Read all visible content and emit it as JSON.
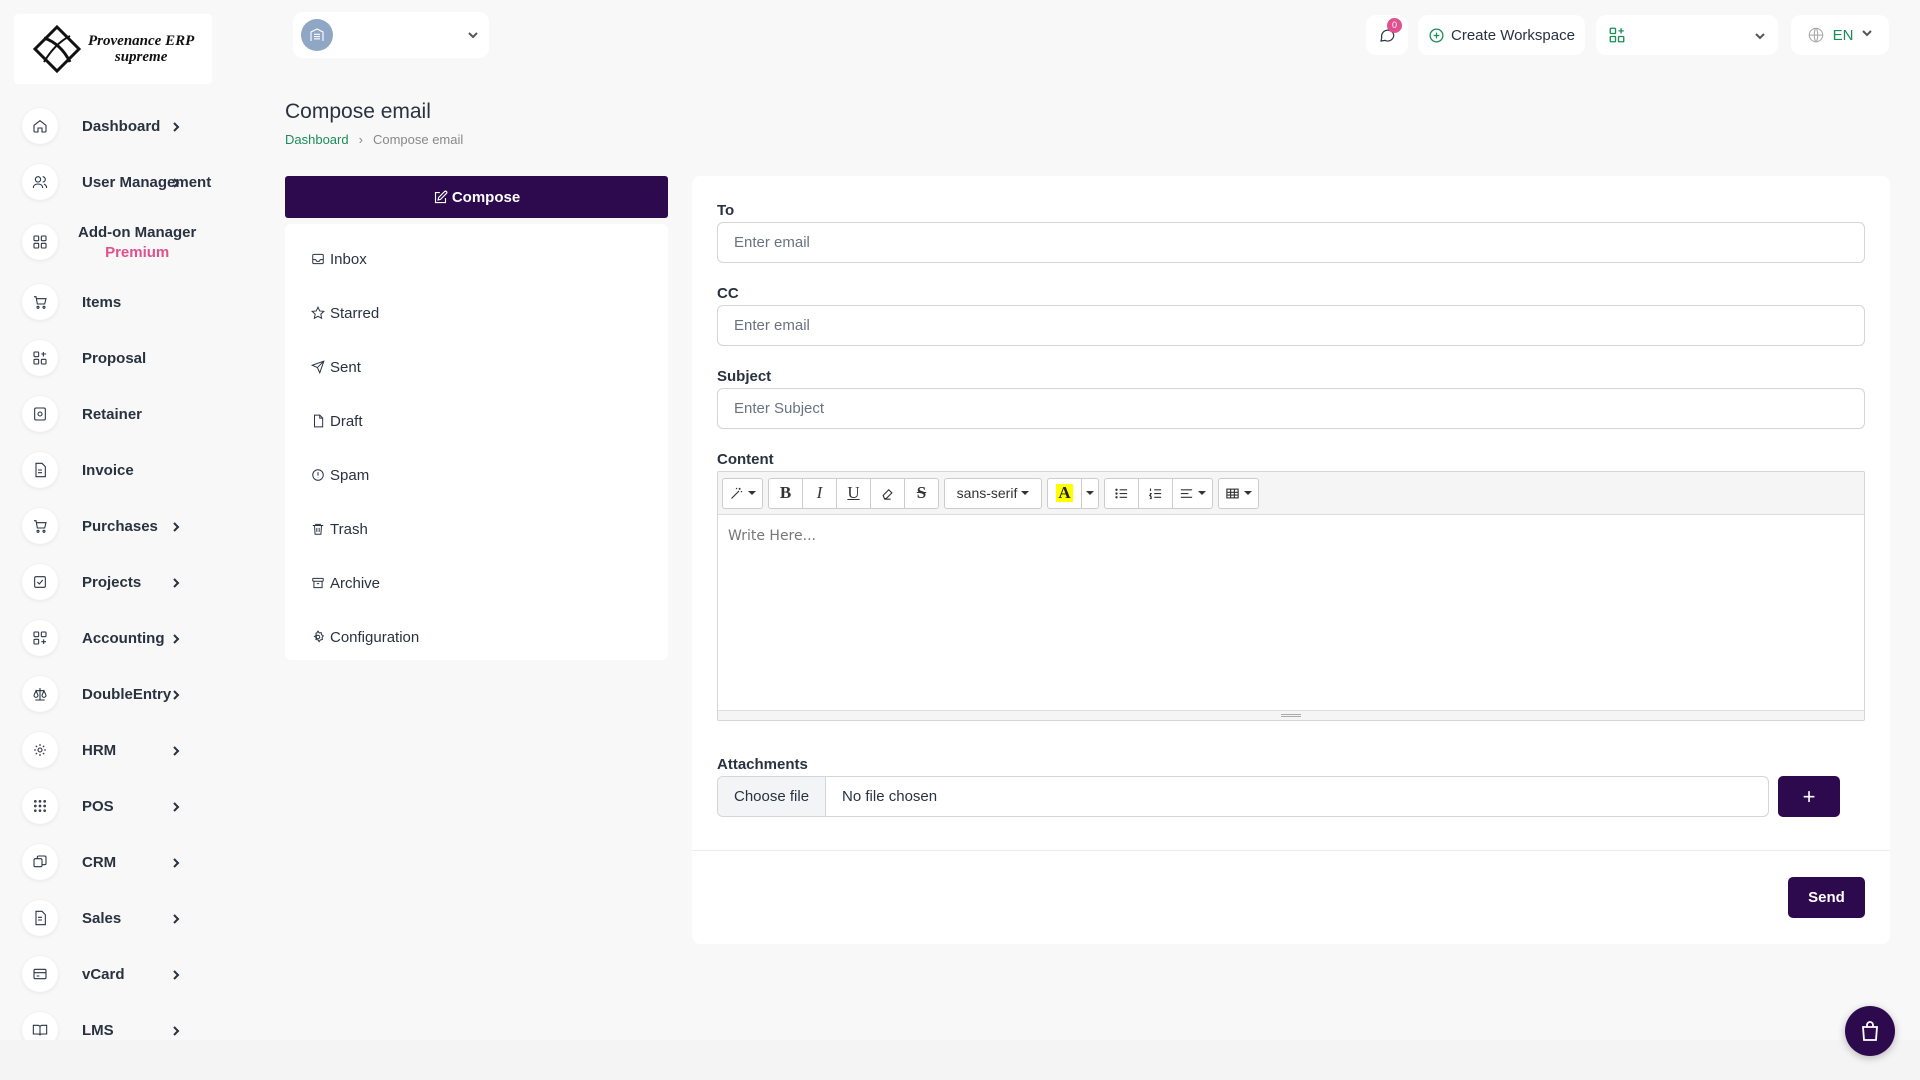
{
  "brand": {
    "line1": "Provenance ERP",
    "line2": "supreme"
  },
  "sidebar": {
    "items": [
      {
        "label": "Dashboard",
        "icon": "home-icon",
        "chevron": true
      },
      {
        "label": "User Management",
        "icon": "users-icon",
        "chevron": true
      },
      {
        "label": "Add-on Manager",
        "sub": "Premium",
        "icon": "addon-icon",
        "chevron": false
      },
      {
        "label": "Items",
        "icon": "cart-icon",
        "chevron": false
      },
      {
        "label": "Proposal",
        "icon": "proposal-icon",
        "chevron": false
      },
      {
        "label": "Retainer",
        "icon": "retainer-icon",
        "chevron": false
      },
      {
        "label": "Invoice",
        "icon": "invoice-icon",
        "chevron": false
      },
      {
        "label": "Purchases",
        "icon": "cart-icon",
        "chevron": true
      },
      {
        "label": "Projects",
        "icon": "check-square-icon",
        "chevron": true
      },
      {
        "label": "Accounting",
        "icon": "grid-plus-icon",
        "chevron": true
      },
      {
        "label": "DoubleEntry",
        "icon": "scale-icon",
        "chevron": true
      },
      {
        "label": "HRM",
        "icon": "hrm-icon",
        "chevron": true
      },
      {
        "label": "POS",
        "icon": "dots-grid-icon",
        "chevron": true
      },
      {
        "label": "CRM",
        "icon": "crm-icon",
        "chevron": true
      },
      {
        "label": "Sales",
        "icon": "file-icon",
        "chevron": true
      },
      {
        "label": "vCard",
        "icon": "card-icon",
        "chevron": true
      },
      {
        "label": "LMS",
        "icon": "book-icon",
        "chevron": true
      }
    ]
  },
  "header": {
    "notification_count": "0",
    "create_workspace": "Create Workspace",
    "language": "EN"
  },
  "page": {
    "title": "Compose email",
    "breadcrumb": {
      "home": "Dashboard",
      "current": "Compose email"
    }
  },
  "mail_nav": {
    "compose": "Compose",
    "items": [
      {
        "label": "Inbox",
        "icon": "inbox-icon"
      },
      {
        "label": "Starred",
        "icon": "star-icon"
      },
      {
        "label": "Sent",
        "icon": "send-icon"
      },
      {
        "label": "Draft",
        "icon": "draft-icon"
      },
      {
        "label": "Spam",
        "icon": "spam-icon"
      },
      {
        "label": "Trash",
        "icon": "trash-icon"
      },
      {
        "label": "Archive",
        "icon": "archive-icon"
      },
      {
        "label": "Configuration",
        "icon": "gear-icon"
      }
    ]
  },
  "form": {
    "to_label": "To",
    "to_placeholder": "Enter email",
    "cc_label": "CC",
    "cc_placeholder": "Enter email",
    "subject_label": "Subject",
    "subject_placeholder": "Enter Subject",
    "content_label": "Content",
    "editor_placeholder": "Write Here...",
    "font_name": "sans-serif",
    "attachments_label": "Attachments",
    "choose_file": "Choose file",
    "no_file": "No file chosen",
    "add_symbol": "+",
    "send": "Send"
  },
  "colors": {
    "primary": "#2d0a4e",
    "accent_green": "#1a8d5a",
    "premium_pink": "#e0508e",
    "highlight": "#ffff00"
  }
}
